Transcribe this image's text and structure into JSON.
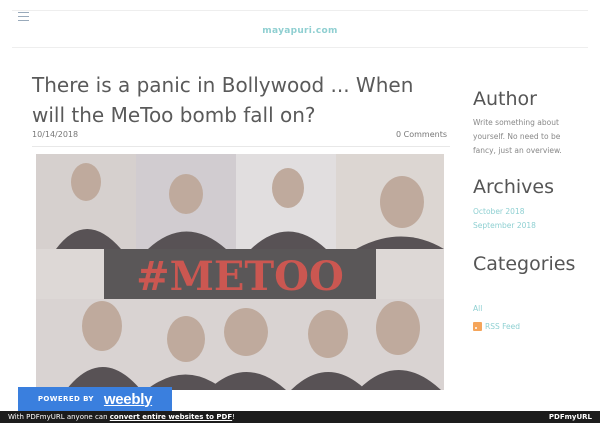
{
  "header": {
    "site_title": "mayapuri.com"
  },
  "post": {
    "title": "There is a panic in Bollywood ... When will the MeToo bomb fall on?",
    "date": "10/14/2018",
    "comments": "0 Comments",
    "image_caption_text": "#METOO"
  },
  "sidebar": {
    "author_heading": "Author",
    "author_text": "Write something about yourself. No need to be fancy, just an overview.",
    "archives_heading": "Archives",
    "archives": [
      "October 2018",
      "September 2018"
    ],
    "categories_heading": "Categories",
    "categories": [
      "All"
    ],
    "rss_label": "RSS Feed"
  },
  "badge": {
    "powered_by": "POWERED BY",
    "logo": "weebly"
  },
  "pdf_bar": {
    "prefix": "With PDFmyURL anyone can ",
    "link": "convert entire websites to PDF",
    "suffix": "!",
    "logo": "PDFmyURL"
  },
  "colors": {
    "accent": "#8fd0d2",
    "badge_blue": "#3a7fde",
    "title_gray": "#5a5a5a",
    "metoo_red": "#c23a33",
    "bar_dark": "#1c1c1c"
  },
  "icons": [
    "hamburger-menu-icon",
    "rss-icon"
  ]
}
